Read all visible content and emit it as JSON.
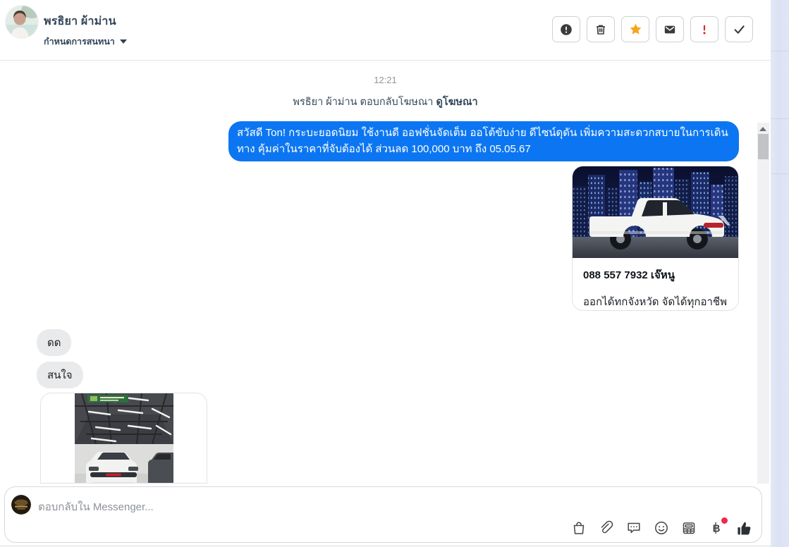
{
  "header": {
    "name": "พรธิยา ผ้าม่าน",
    "subtitle": "กำหนดการสนทนา",
    "actions": [
      {
        "icon": "report-icon"
      },
      {
        "icon": "trash-icon"
      },
      {
        "icon": "star-icon"
      },
      {
        "icon": "mark-unread-icon"
      },
      {
        "icon": "flag-important-icon"
      },
      {
        "icon": "mark-done-icon"
      }
    ]
  },
  "conversation": {
    "timestamp": "12:21",
    "ad_reply_prefix": "พรธิยา ผ้าม่าน ตอบกลับโฆษณา ",
    "ad_reply_link": "ดูโฆษณา",
    "outgoing_message": "สวัสดี Ton! กระบะยอดนิยม ใช้งานดี ออฟชั่นจัดเต็ม ออโต้ขับง่าย ดีไซน์ดุดัน เพิ่มความสะดวกสบายในการเดินทาง คุ้มค่าในราคาที่จับต้องได้ ส่วนลด 100,000 บาท ถึง 05.05.67",
    "ad_card": {
      "title": "088 557 7932 เจ๊หนู",
      "subtitle": "ออกได้ทกจังหวัด จัดได้ทุกอาชีพ",
      "image": "white-pickup-truck-night-city"
    },
    "incoming": [
      "ดด",
      "สนใจ"
    ],
    "photo_message": "car-showroom-photo"
  },
  "composer": {
    "placeholder": "ตอบกลับใน Messenger...",
    "icons": [
      "shopping-bag-icon",
      "attachment-icon",
      "saved-reply-icon",
      "emoji-icon",
      "invoice-icon",
      "payment-baht-icon",
      "like-icon"
    ]
  },
  "colors": {
    "bubble_blue": "#0c76f2",
    "incoming_gray": "#e9eaeb",
    "star_orange": "#f7a51d",
    "alert_red": "#e0251f",
    "badge_red": "#f02849",
    "icon_dark": "#3a3b3c",
    "name_text": "#33465a",
    "timestamp_gray": "#90959b",
    "right_strip": "#dce2f4"
  }
}
